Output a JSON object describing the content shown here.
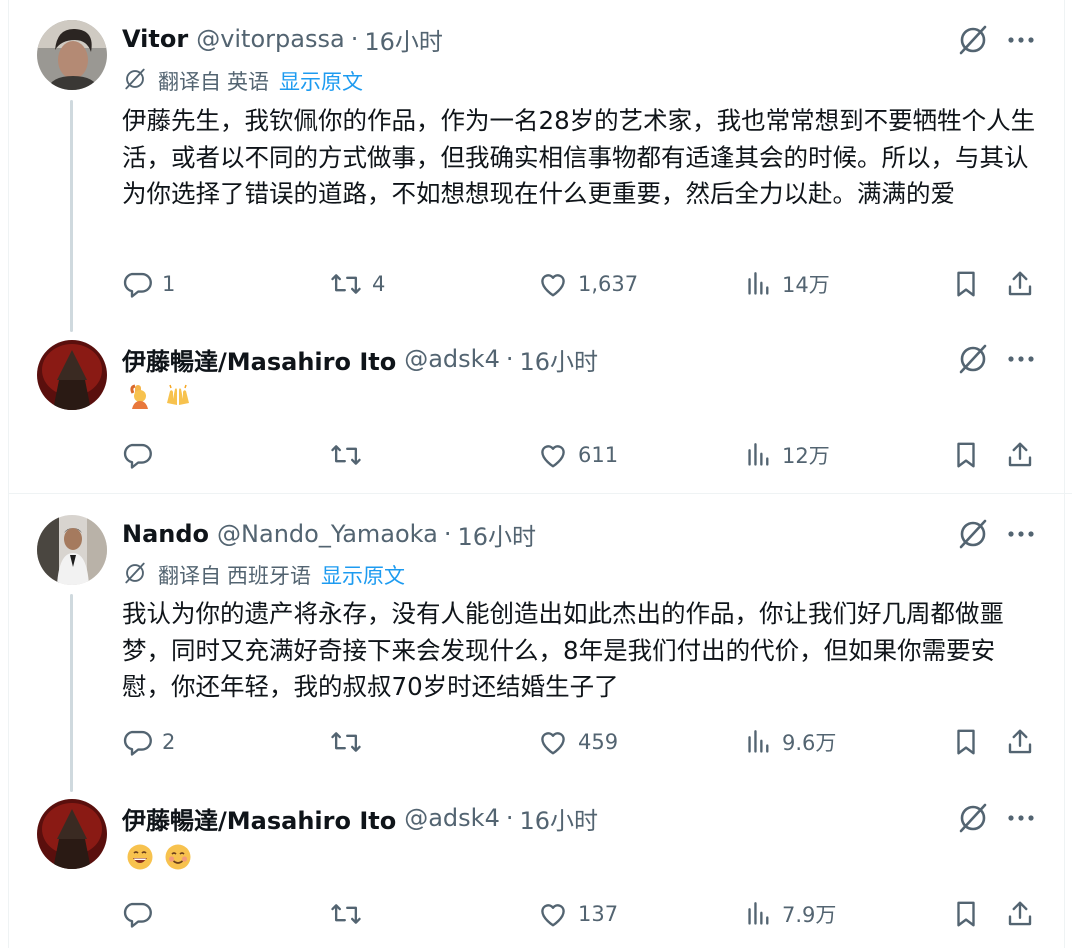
{
  "tweets": [
    {
      "name": "Vitor",
      "handle": "@vitorpassa",
      "dot": "·",
      "time": "16小时",
      "translate": {
        "prefix": "翻译自",
        "lang": "英语",
        "show": "显示原文"
      },
      "text": "伊藤先生，我钦佩你的作品，作为一名28岁的艺术家，我也常常想到不要牺牲个人生活，或者以不同的方式做事，但我确实相信事物都有适逢其会的时候。所以，与其认为你选择了错误的道路，不如想想现在什么更重要，然后全力以赴。满满的爱",
      "replies": "1",
      "reposts": "4",
      "likes": "1,637",
      "views": "14万"
    },
    {
      "name": "伊藤暢達/Masahiro Ito",
      "handle": "@adsk4",
      "dot": "·",
      "time": "16小时",
      "emojis": [
        "raising-hand-emoji",
        "raised-hands-emoji"
      ],
      "replies": "",
      "reposts": "",
      "likes": "611",
      "views": "12万"
    },
    {
      "name": "Nando",
      "handle": "@Nando_Yamaoka",
      "dot": "·",
      "time": "16小时",
      "translate": {
        "prefix": "翻译自",
        "lang": "西班牙语",
        "show": "显示原文"
      },
      "text": "我认为你的遗产将永存，没有人能创造出如此杰出的作品，你让我们好几周都做噩梦，同时又充满好奇接下来会发现什么，8年是我们付出的代价，但如果你需要安慰，你还年轻，我的叔叔70岁时还结婚生子了",
      "replies": "2",
      "reposts": "",
      "likes": "459",
      "views": "9.6万"
    },
    {
      "name": "伊藤暢達/Masahiro Ito",
      "handle": "@adsk4",
      "dot": "·",
      "time": "16小时",
      "emojis": [
        "grinning-face-emoji",
        "smiling-face-emoji"
      ],
      "replies": "",
      "reposts": "",
      "likes": "137",
      "views": "7.9万"
    }
  ],
  "colors": {
    "accent": "#1d9bf0",
    "secondary_text": "#536471",
    "thread_line": "#cfd9de",
    "divider": "#eff3f4"
  }
}
